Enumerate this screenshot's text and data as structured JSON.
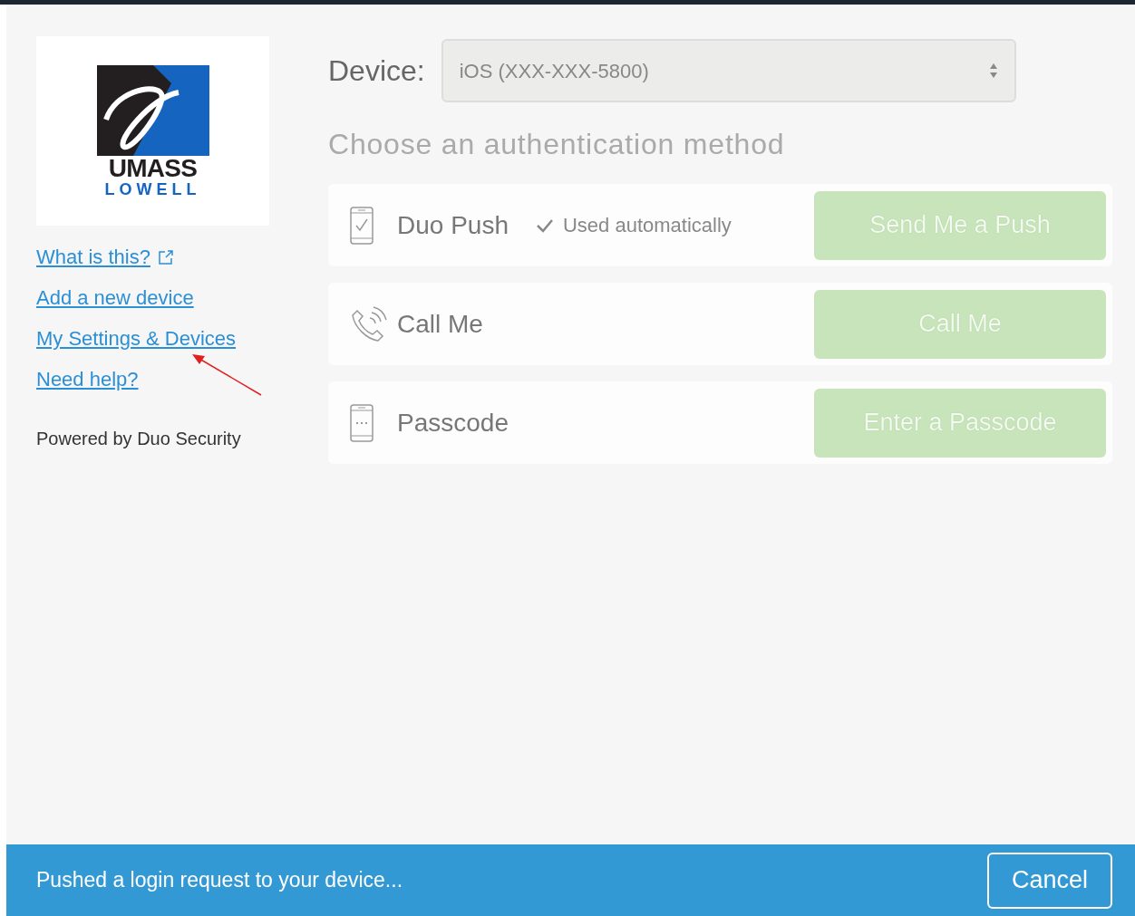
{
  "logo": {
    "line1": "UMASS",
    "line2": "LOWELL"
  },
  "links": [
    {
      "label": "What is this?",
      "external": true
    },
    {
      "label": "Add a new device",
      "external": false
    },
    {
      "label": "My Settings & Devices",
      "external": false
    },
    {
      "label": "Need help?",
      "external": false
    }
  ],
  "powered_by": "Powered by Duo Security",
  "device": {
    "label": "Device:",
    "value": "iOS (XXX-XXX-5800)",
    "disabled": true
  },
  "heading": "Choose an authentication method",
  "methods": [
    {
      "kind": "push",
      "label": "Duo Push",
      "note": "Used automatically",
      "button": "Send Me a Push",
      "disabled": true
    },
    {
      "kind": "call",
      "label": "Call Me",
      "button": "Call Me",
      "disabled": true
    },
    {
      "kind": "passcode",
      "label": "Passcode",
      "button": "Enter a Passcode",
      "disabled": true
    }
  ],
  "status_bar": {
    "message": "Pushed a login request to your device...",
    "button": "Cancel"
  }
}
